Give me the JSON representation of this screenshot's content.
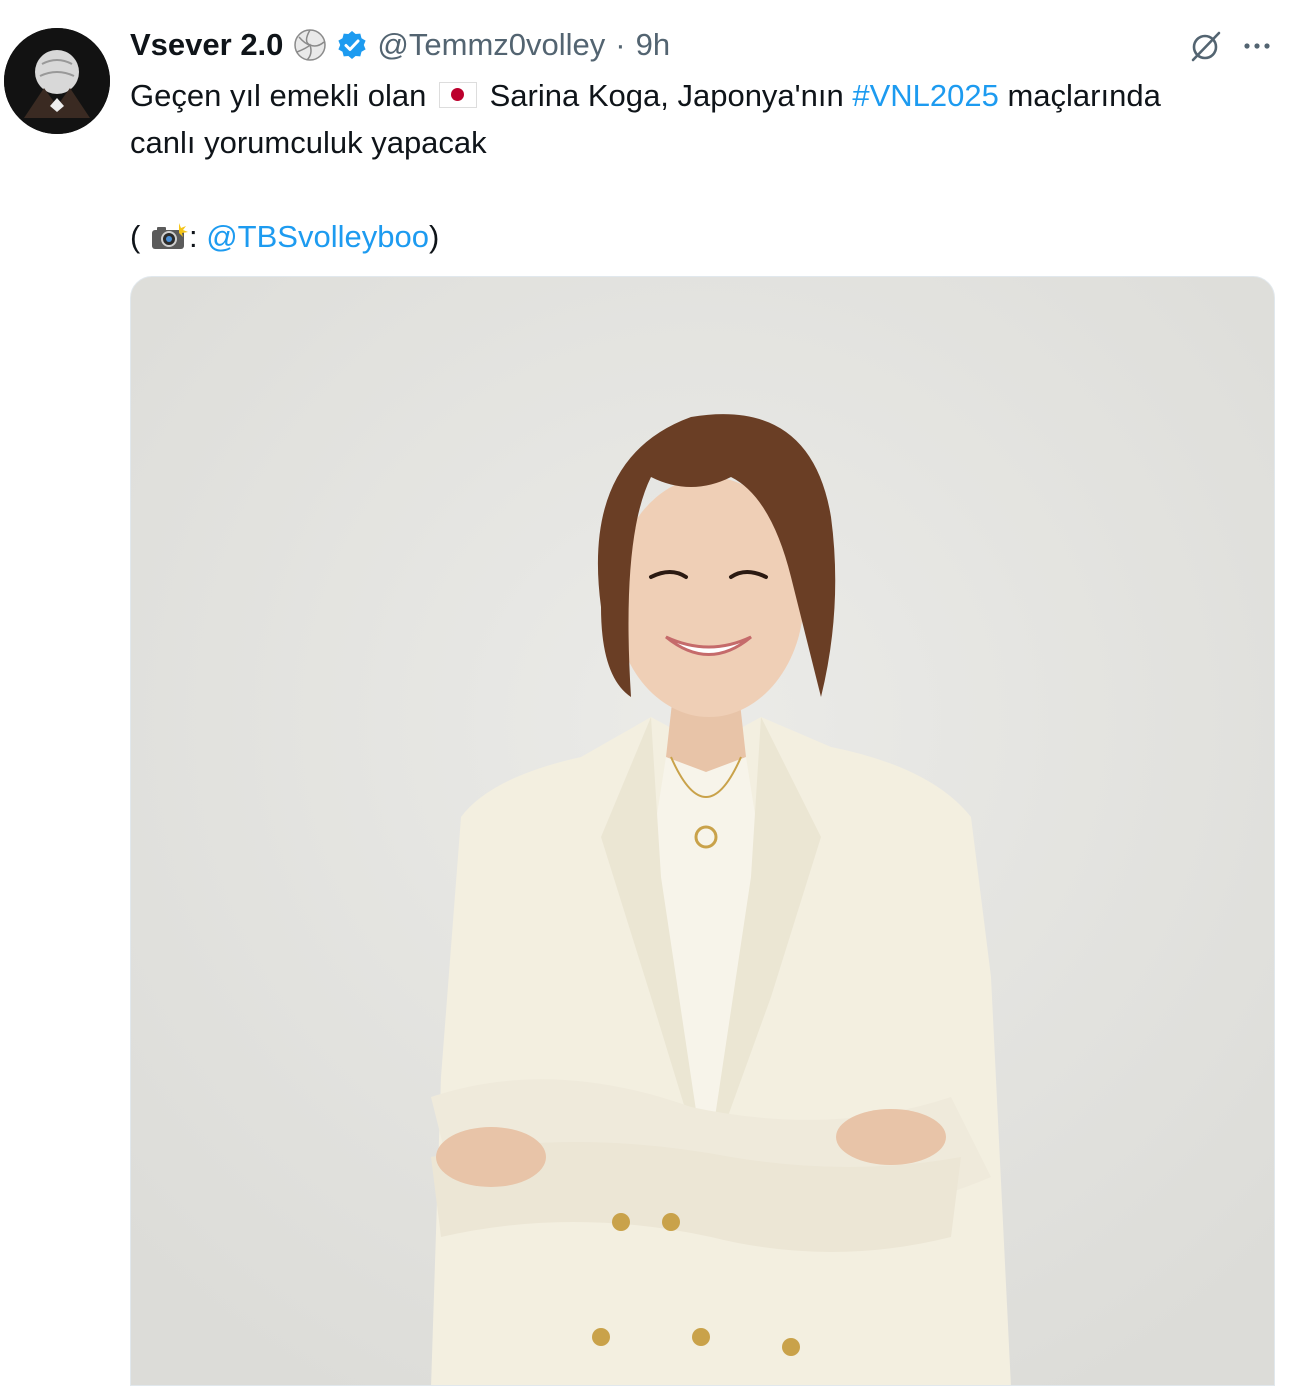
{
  "tweet": {
    "author": {
      "display_name": "Vsever 2.0",
      "handle": "@Temmz0volley",
      "badge_emoji": "volleyball-icon",
      "verified": true
    },
    "separator": "·",
    "time": "9h",
    "text": {
      "line1_before_flag": "Geçen yıl emekli olan",
      "line1_after_flag": "Sarina Koga, Japonya'nın",
      "hashtag": "#VNL2025",
      "line1_end": "maçlarında",
      "line2": "canlı yorumculuk yapacak",
      "credit_open": "(",
      "credit_colon": ":",
      "credit_mention": "@TBSvolleyboo",
      "credit_close": ")"
    },
    "icons": {
      "flag": "japan-flag-icon",
      "camera": "camera-with-flash-icon",
      "grok": "grok-icon",
      "more": "more-options-icon"
    },
    "colors": {
      "link": "#1d9bf0",
      "verified": "#1d9bf0",
      "secondary_text": "#536471",
      "primary_text": "#0f1419"
    }
  }
}
